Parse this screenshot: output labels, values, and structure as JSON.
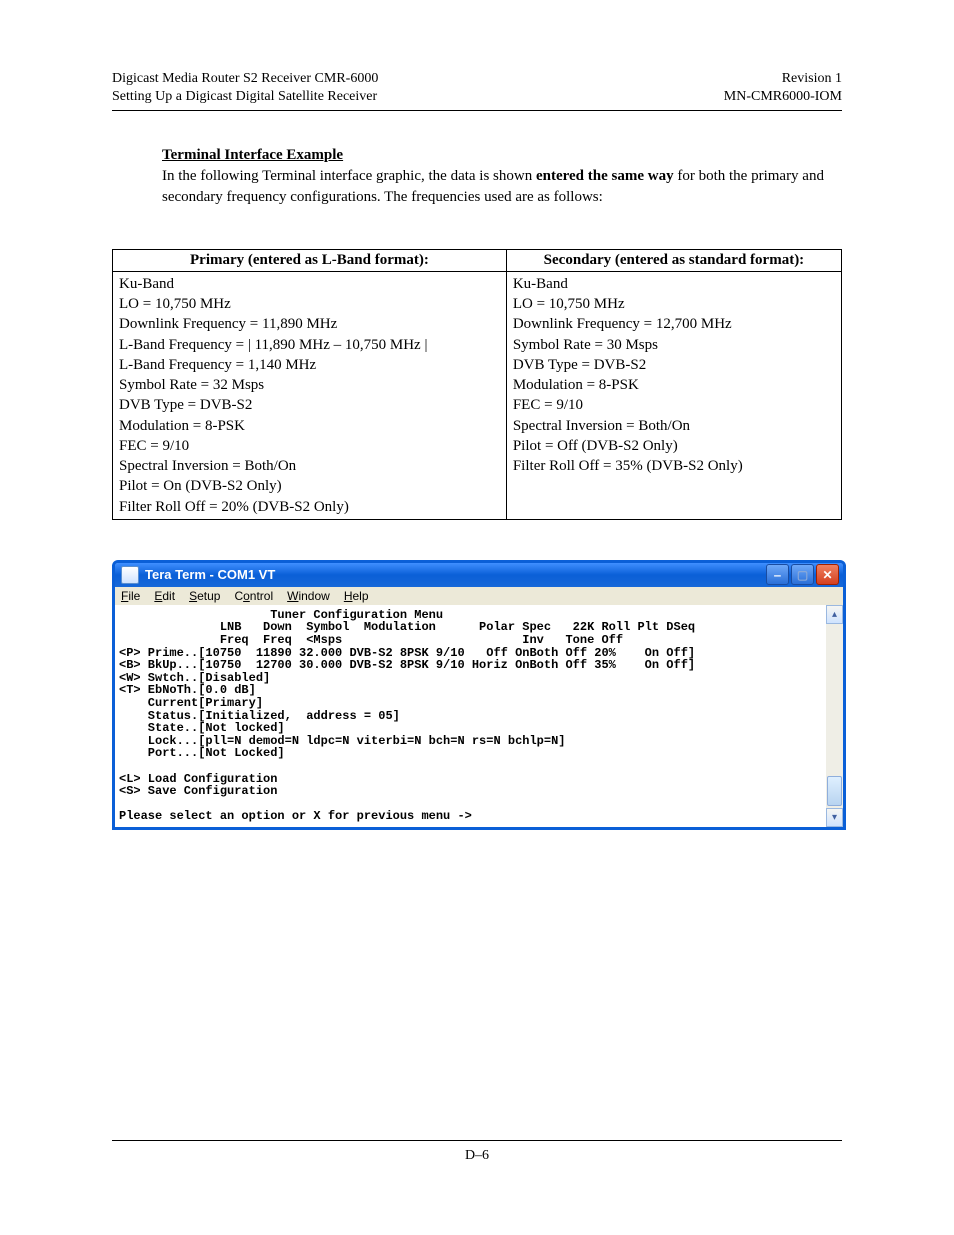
{
  "header": {
    "left_line1": "Digicast Media Router S2 Receiver CMR-6000",
    "left_line2": "Setting Up a Digicast Digital Satellite Receiver",
    "right_line1": "Revision 1",
    "right_line2": "MN-CMR6000-IOM"
  },
  "section": {
    "title": "Terminal Interface Example",
    "intro_pre": "In the following Terminal interface graphic, the data is shown ",
    "intro_bold": "entered the same way",
    "intro_post": " for both the primary and secondary frequency configurations.  The frequencies used are as follows:"
  },
  "table": {
    "primary_header": "Primary (entered as L-Band format):",
    "secondary_header": "Secondary (entered as standard format):",
    "primary_lines": [
      "Ku-Band",
      "LO = 10,750 MHz",
      "Downlink Frequency = 11,890 MHz",
      "L-Band Frequency = | 11,890 MHz – 10,750 MHz |",
      "L-Band Frequency = 1,140 MHz",
      "Symbol Rate = 32 Msps",
      "DVB Type = DVB-S2",
      "Modulation = 8-PSK",
      "FEC = 9/10",
      "Spectral Inversion = Both/On",
      "Pilot = On (DVB-S2 Only)",
      "Filter Roll Off = 20% (DVB-S2 Only)"
    ],
    "secondary_lines": [
      "Ku-Band",
      "LO = 10,750 MHz",
      "Downlink Frequency = 12,700 MHz",
      "Symbol Rate = 30 Msps",
      "DVB Type = DVB-S2",
      "Modulation = 8-PSK",
      "FEC = 9/10",
      "Spectral Inversion = Both/On",
      "Pilot = Off (DVB-S2 Only)",
      "Filter Roll Off = 35% (DVB-S2 Only)"
    ]
  },
  "terminal": {
    "window_title": "Tera Term - COM1 VT",
    "menus": {
      "file": "File",
      "edit": "Edit",
      "setup": "Setup",
      "control": "Control",
      "window": "Window",
      "help": "Help"
    },
    "body": "                     Tuner Configuration Menu\n              LNB   Down  Symbol  Modulation      Polar Spec   22K Roll Plt DSeq\n              Freq  Freq  <Msps                         Inv   Tone Off\n<P> Prime..[10750  11890 32.000 DVB-S2 8PSK 9/10   Off OnBoth Off 20%    On Off]\n<B> BkUp...[10750  12700 30.000 DVB-S2 8PSK 9/10 Horiz OnBoth Off 35%    On Off]\n<W> Swtch..[Disabled]\n<T> EbNoTh.[0.0 dB]\n    Current[Primary]\n    Status.[Initialized,  address = 05]\n    State..[Not locked]\n    Lock...[pll=N demod=N ldpc=N viterbi=N bch=N rs=N bchlp=N]\n    Port...[Not Locked]\n\n<L> Load Configuration\n<S> Save Configuration\n\nPlease select an option or X for previous menu ->"
  },
  "footer": {
    "page_number": "D–6"
  }
}
